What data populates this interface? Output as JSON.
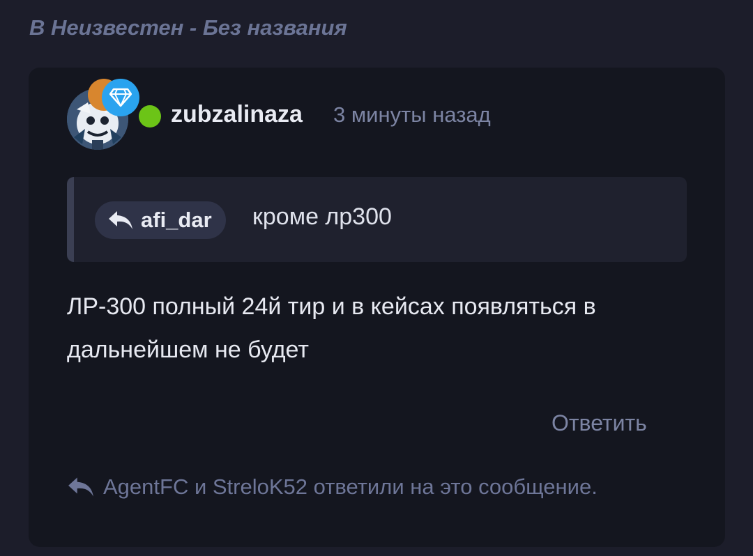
{
  "thread": {
    "title": "В Неизвестен - Без названия"
  },
  "post": {
    "author": {
      "username": "zubzalinaza",
      "status": "online",
      "status_color": "#6cc417",
      "badges": [
        "orange-badge",
        "diamond-icon"
      ]
    },
    "timestamp": "3 минуты назад",
    "quote": {
      "author": "afi_dar",
      "text": "кроме лр300"
    },
    "message": "ЛР-300 полный 24й тир и в кейсах появляться в дальнейшем не будет",
    "reply_label": "Ответить",
    "replied_info": "AgentFC и StreloK52 ответили на это сообщение."
  },
  "colors": {
    "page_bg": "#1c1d2a",
    "card_bg": "#14161f",
    "quote_bg": "#1f212e",
    "chip_bg": "#2f3348",
    "diamond_badge": "#2aa3ef",
    "orange_badge": "#d8862e"
  }
}
